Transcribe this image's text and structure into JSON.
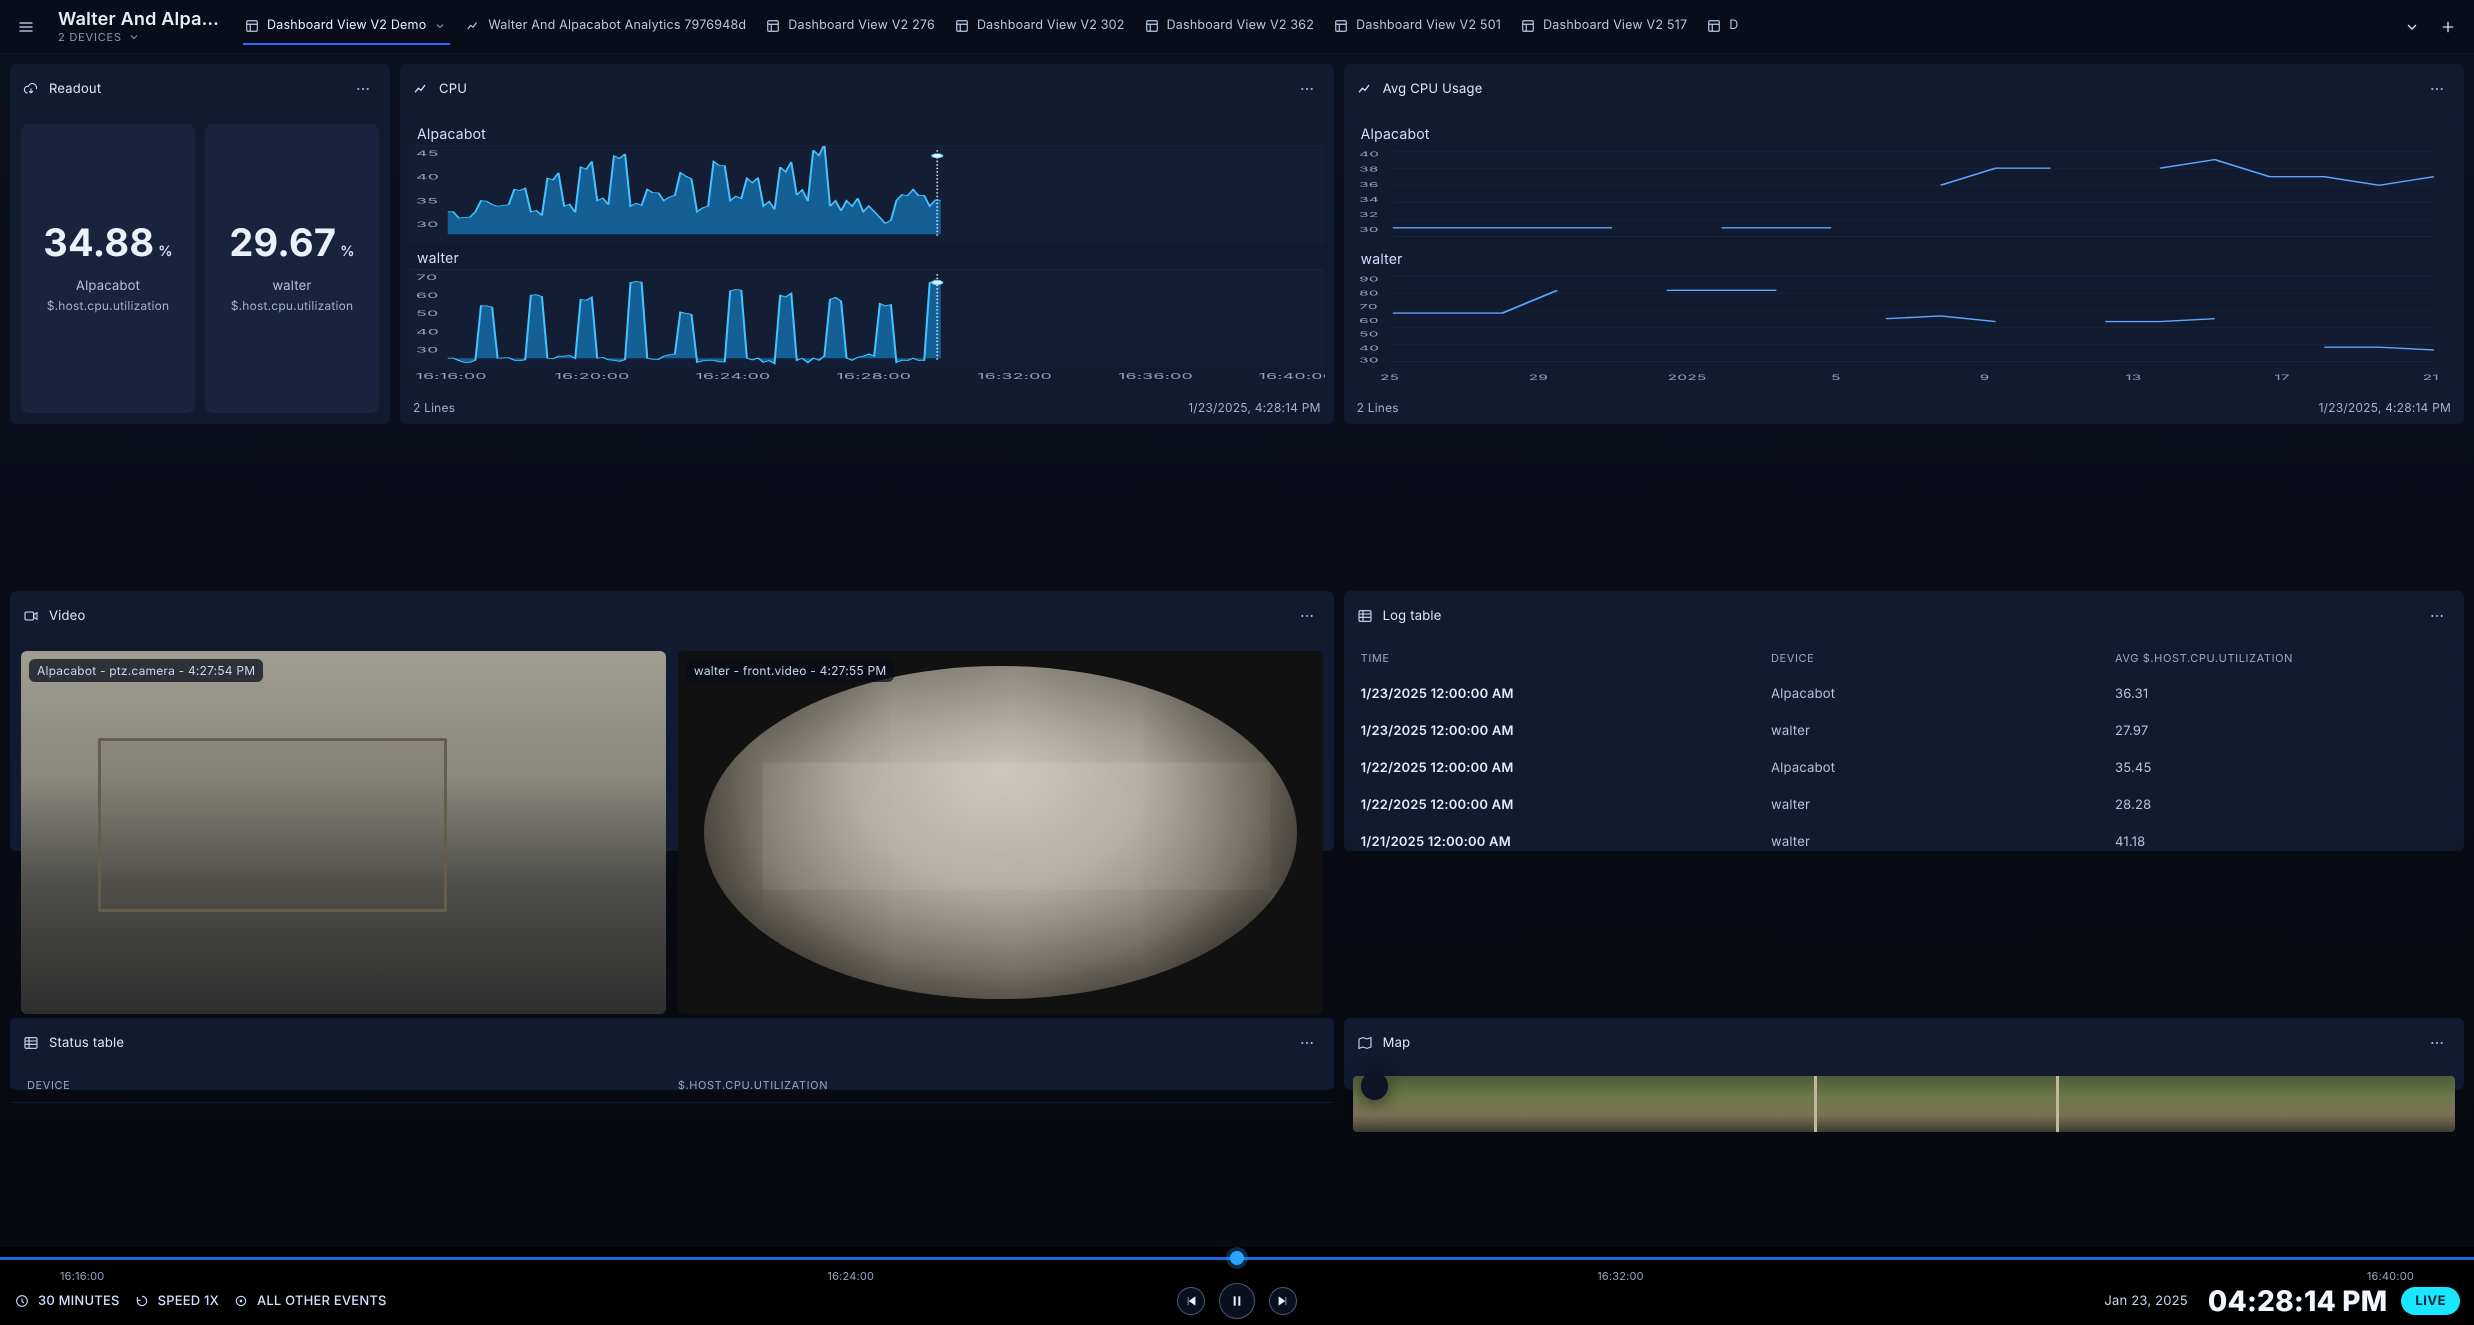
{
  "header": {
    "title": "Walter And Alpa…",
    "devices_label": "2 DEVICES"
  },
  "tabs": [
    {
      "label": "Dashboard View V2 Demo",
      "icon": "layout-icon",
      "active": true,
      "hasMenu": true
    },
    {
      "label": "Walter And Alpacabot Analytics 7976948d",
      "icon": "chart-line-icon"
    },
    {
      "label": "Dashboard View V2 276",
      "icon": "layout-icon"
    },
    {
      "label": "Dashboard View V2 302",
      "icon": "layout-icon"
    },
    {
      "label": "Dashboard View V2 362",
      "icon": "layout-icon"
    },
    {
      "label": "Dashboard View V2 501",
      "icon": "layout-icon"
    },
    {
      "label": "Dashboard View V2 517",
      "icon": "layout-icon"
    },
    {
      "label": "D",
      "icon": "layout-icon"
    }
  ],
  "readout": {
    "title": "Readout",
    "left": {
      "value": "34.88",
      "unit": "%",
      "device": "Alpacabot",
      "metric": "$.host.cpu.utilization"
    },
    "right": {
      "value": "29.67",
      "unit": "%",
      "device": "walter",
      "metric": "$.host.cpu.utilization"
    }
  },
  "cpu": {
    "title": "CPU",
    "series": [
      {
        "name": "Alpacabot",
        "yTicks": [
          "45",
          "40",
          "35",
          "30"
        ]
      },
      {
        "name": "walter",
        "yTicks": [
          "70",
          "60",
          "50",
          "40",
          "30"
        ]
      }
    ],
    "xTicks": [
      "16:16:00",
      "16:20:00",
      "16:24:00",
      "16:28:00",
      "16:32:00",
      "16:36:00",
      "16:40:00"
    ],
    "lines": "2 Lines",
    "timestamp": "1/23/2025, 4:28:14 PM"
  },
  "avg": {
    "title": "Avg CPU Usage",
    "series": [
      {
        "name": "Alpacabot",
        "yTicks": [
          "40",
          "38",
          "36",
          "34",
          "32",
          "30"
        ]
      },
      {
        "name": "walter",
        "yTicks": [
          "90",
          "80",
          "70",
          "60",
          "50",
          "40",
          "30"
        ]
      }
    ],
    "xTicks": [
      "25",
      "29",
      "2025",
      "5",
      "9",
      "13",
      "17",
      "21"
    ],
    "lines": "2 Lines",
    "timestamp": "1/23/2025, 4:28:14 PM"
  },
  "chart_data": [
    {
      "type": "line",
      "title": "CPU",
      "xlabel": "time",
      "series": [
        {
          "name": "Alpacabot",
          "ylim": [
            30,
            45
          ],
          "values": [
            34,
            33,
            36,
            35,
            38,
            34,
            40,
            35,
            42,
            36,
            44,
            35,
            38,
            36,
            41,
            34,
            43,
            36,
            40,
            35,
            42,
            37,
            45,
            35,
            36,
            34,
            33,
            36,
            38,
            35
          ]
        },
        {
          "name": "walter",
          "ylim": [
            30,
            70
          ],
          "values": [
            30,
            28,
            55,
            30,
            29,
            60,
            30,
            31,
            58,
            30,
            29,
            66,
            30,
            31,
            52,
            28,
            29,
            62,
            30,
            28,
            60,
            29,
            30,
            58,
            30,
            31,
            56,
            28,
            30,
            66
          ]
        }
      ],
      "xticks": [
        "16:16:00",
        "16:20:00",
        "16:24:00",
        "16:28:00",
        "16:32:00",
        "16:36:00",
        "16:40:00"
      ]
    },
    {
      "type": "line",
      "title": "Avg CPU Usage",
      "xlabel": "day",
      "series": [
        {
          "name": "Alpacabot",
          "ylim": [
            30,
            40
          ],
          "values": [
            31,
            31,
            31,
            31,
            31,
            31,
            31,
            31,
            31,
            32,
            36,
            38,
            38,
            38,
            38,
            39,
            37,
            37,
            36,
            37
          ]
        },
        {
          "name": "walter",
          "ylim": [
            30,
            90
          ],
          "values": [
            64,
            64,
            64,
            80,
            80,
            80,
            80,
            80,
            60,
            60,
            62,
            58,
            58,
            58,
            58,
            60,
            54,
            40,
            40,
            38
          ]
        }
      ],
      "xticks": [
        "25",
        "29",
        "2025",
        "5",
        "9",
        "13",
        "17",
        "21"
      ]
    }
  ],
  "video": {
    "title": "Video",
    "feeds": [
      {
        "overlay": "Alpacabot - ptz.camera - 4:27:54 PM"
      },
      {
        "overlay": "walter - front.video - 4:27:55 PM"
      }
    ]
  },
  "logtable": {
    "title": "Log table",
    "columns": [
      "TIME",
      "DEVICE",
      "AVG $.HOST.CPU.UTILIZATION"
    ],
    "rows": [
      {
        "time": "1/23/2025 12:00:00 AM",
        "device": "Alpacabot",
        "avg": "36.31"
      },
      {
        "time": "1/23/2025 12:00:00 AM",
        "device": "walter",
        "avg": "27.97"
      },
      {
        "time": "1/22/2025 12:00:00 AM",
        "device": "Alpacabot",
        "avg": "35.45"
      },
      {
        "time": "1/22/2025 12:00:00 AM",
        "device": "walter",
        "avg": "28.28"
      },
      {
        "time": "1/21/2025 12:00:00 AM",
        "device": "walter",
        "avg": "41.18"
      }
    ]
  },
  "statustable": {
    "title": "Status table",
    "columns": [
      "DEVICE",
      "$.HOST.CPU.UTILIZATION"
    ]
  },
  "map": {
    "title": "Map"
  },
  "playbar": {
    "ticks": [
      "16:16:00",
      "16:24:00",
      "16:32:00",
      "16:40:00"
    ],
    "range_label": "30 MINUTES",
    "speed_label": "SPEED 1X",
    "filter_label": "ALL OTHER EVENTS",
    "date": "Jan 23, 2025",
    "time": "04:28:14 PM",
    "live": "LIVE"
  }
}
